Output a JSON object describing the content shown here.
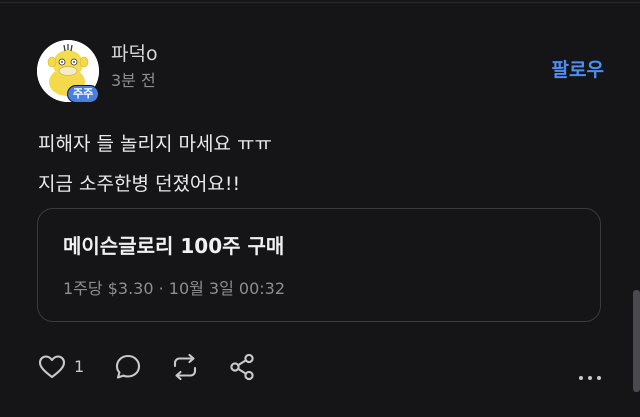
{
  "post": {
    "author": "파덕o",
    "time": "3분 전",
    "badge": "주주",
    "follow_label": "팔로우",
    "body_lines": [
      "피해자 들 놀리지 마세요 ㅠㅠ",
      "지금 소주한병 던졌어요!!"
    ]
  },
  "trade": {
    "title": "메이슨글로리 100주 구매",
    "meta": "1주당 $3.30 · 10월 3일 00:32"
  },
  "actions": {
    "like_count": "1",
    "icons": [
      "heart-icon",
      "comment-icon",
      "repost-icon",
      "share-icon",
      "more-icon"
    ]
  },
  "colors": {
    "background": "#151518",
    "accent": "#4d8ff0",
    "muted_text": "#8d8d92",
    "card_border": "#3a3a3f"
  }
}
